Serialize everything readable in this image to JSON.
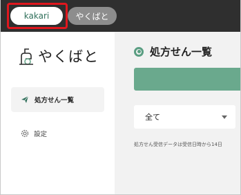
{
  "tabs": [
    {
      "label": "kakari"
    },
    {
      "label": "やくばと"
    }
  ],
  "sidebar": {
    "logo_text": "やくばと",
    "items": [
      {
        "label": "処方せん一覧",
        "icon": "paper-plane-icon"
      },
      {
        "label": "設定",
        "icon": "gear-icon"
      }
    ]
  },
  "main": {
    "title": "処方せん一覧",
    "filter": {
      "value": "全て"
    },
    "note": "処方せん受信データは受信日時から14日"
  },
  "colors": {
    "accent": "#6aa98d",
    "topbar": "#2f2f2f",
    "highlight": "#e0171e"
  }
}
